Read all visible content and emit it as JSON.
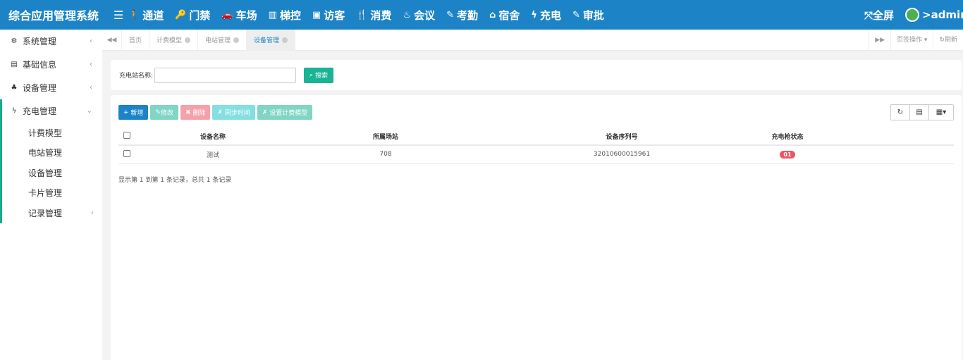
{
  "header": {
    "brand": "综合应用管理系统",
    "nav": [
      {
        "icon": "walk-icon",
        "glyph": "🚶",
        "label": "通道"
      },
      {
        "icon": "key-icon",
        "glyph": "🔑",
        "label": "门禁"
      },
      {
        "icon": "car-icon",
        "glyph": "🚗",
        "label": "车场"
      },
      {
        "icon": "building-icon",
        "glyph": "▥",
        "label": "梯控"
      },
      {
        "icon": "id-card-icon",
        "glyph": "▣",
        "label": "访客"
      },
      {
        "icon": "cutlery-icon",
        "glyph": "🍴",
        "label": "消费"
      },
      {
        "icon": "meeting-icon",
        "glyph": "♨",
        "label": "会议"
      },
      {
        "icon": "edit-icon",
        "glyph": "✎",
        "label": "考勤"
      },
      {
        "icon": "home-icon",
        "glyph": "⌂",
        "label": "宿舍"
      },
      {
        "icon": "bolt-icon",
        "glyph": "ϟ",
        "label": "充电"
      },
      {
        "icon": "edit-icon",
        "glyph": "✎",
        "label": "审批"
      }
    ],
    "fullscreen_label": "全屏",
    "user_label": ">admin"
  },
  "sidebar": {
    "groups": [
      {
        "icon": "gear-icon",
        "glyph": "⚙",
        "label": "系统管理"
      },
      {
        "icon": "id-card-icon",
        "glyph": "▤",
        "label": "基础信息"
      },
      {
        "icon": "cubes-icon",
        "glyph": "♣",
        "label": "设备管理"
      },
      {
        "icon": "bolt-icon",
        "glyph": "ϟ",
        "label": "充电管理"
      }
    ],
    "charging_sub": [
      "计费模型",
      "电站管理",
      "设备管理",
      "卡片管理",
      "记录管理"
    ]
  },
  "tabs": {
    "items": [
      "首页",
      "计费模型",
      "电站管理",
      "设备管理"
    ],
    "active_index": 3,
    "page_ops": "页签操作",
    "refresh": "刷新"
  },
  "search": {
    "label": "充电站名称:",
    "value": "",
    "button": "搜索"
  },
  "toolbar": {
    "add": "新增",
    "edit": "修改",
    "delete": "删除",
    "sync_time": "同步时间",
    "set_model": "设置计费模型"
  },
  "table": {
    "columns": [
      "设备名称",
      "所属场站",
      "设备序列号",
      "充电枪状态"
    ],
    "rows": [
      {
        "name": "测试",
        "station": "708",
        "serial": "32010600015961",
        "gun_status": "01"
      }
    ]
  },
  "pager": {
    "info": "显示第 1 到第 1 条记录，总共 1 条记录"
  },
  "colors": {
    "header_bg": "#1c84c6",
    "accent": "#1ab394",
    "danger": "#ed5565"
  }
}
